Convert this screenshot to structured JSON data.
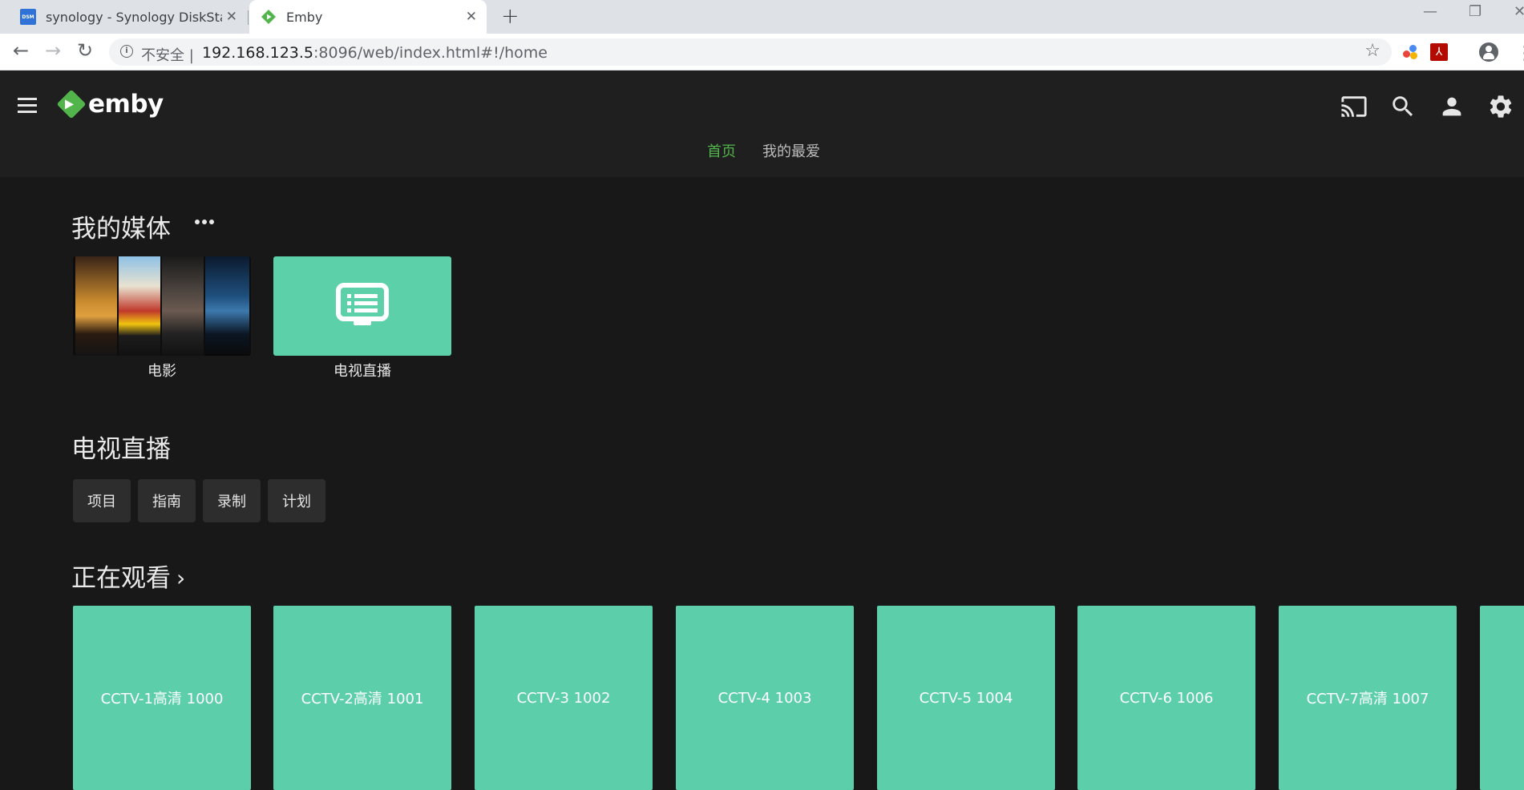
{
  "browser": {
    "tabs": [
      {
        "title": "synology - Synology DiskStation",
        "favicon": "DSM"
      },
      {
        "title": "Emby",
        "favicon": "emby-icon"
      }
    ],
    "address": {
      "security_label": "不安全",
      "separator": "|",
      "url_host": "192.168.123.5",
      "url_rest": ":8096/web/index.html#!/home"
    }
  },
  "header": {
    "logo_text": "emby",
    "nav": {
      "home": "首页",
      "favorites": "我的最爱"
    }
  },
  "my_media": {
    "title": "我的媒体",
    "libraries": [
      {
        "label": "电影"
      },
      {
        "label": "电视直播"
      }
    ]
  },
  "live_tv": {
    "title": "电视直播",
    "buttons": [
      "项目",
      "指南",
      "录制",
      "计划"
    ]
  },
  "now_watching": {
    "title": "正在观看",
    "channels": [
      "CCTV-1高清 1000",
      "CCTV-2高清 1001",
      "CCTV-3 1002",
      "CCTV-4 1003",
      "CCTV-5 1004",
      "CCTV-6 1006",
      "CCTV-7高清 1007"
    ]
  },
  "colors": {
    "accent_green": "#52b54b",
    "tile_teal": "#5cd0a9",
    "background": "#181818"
  }
}
